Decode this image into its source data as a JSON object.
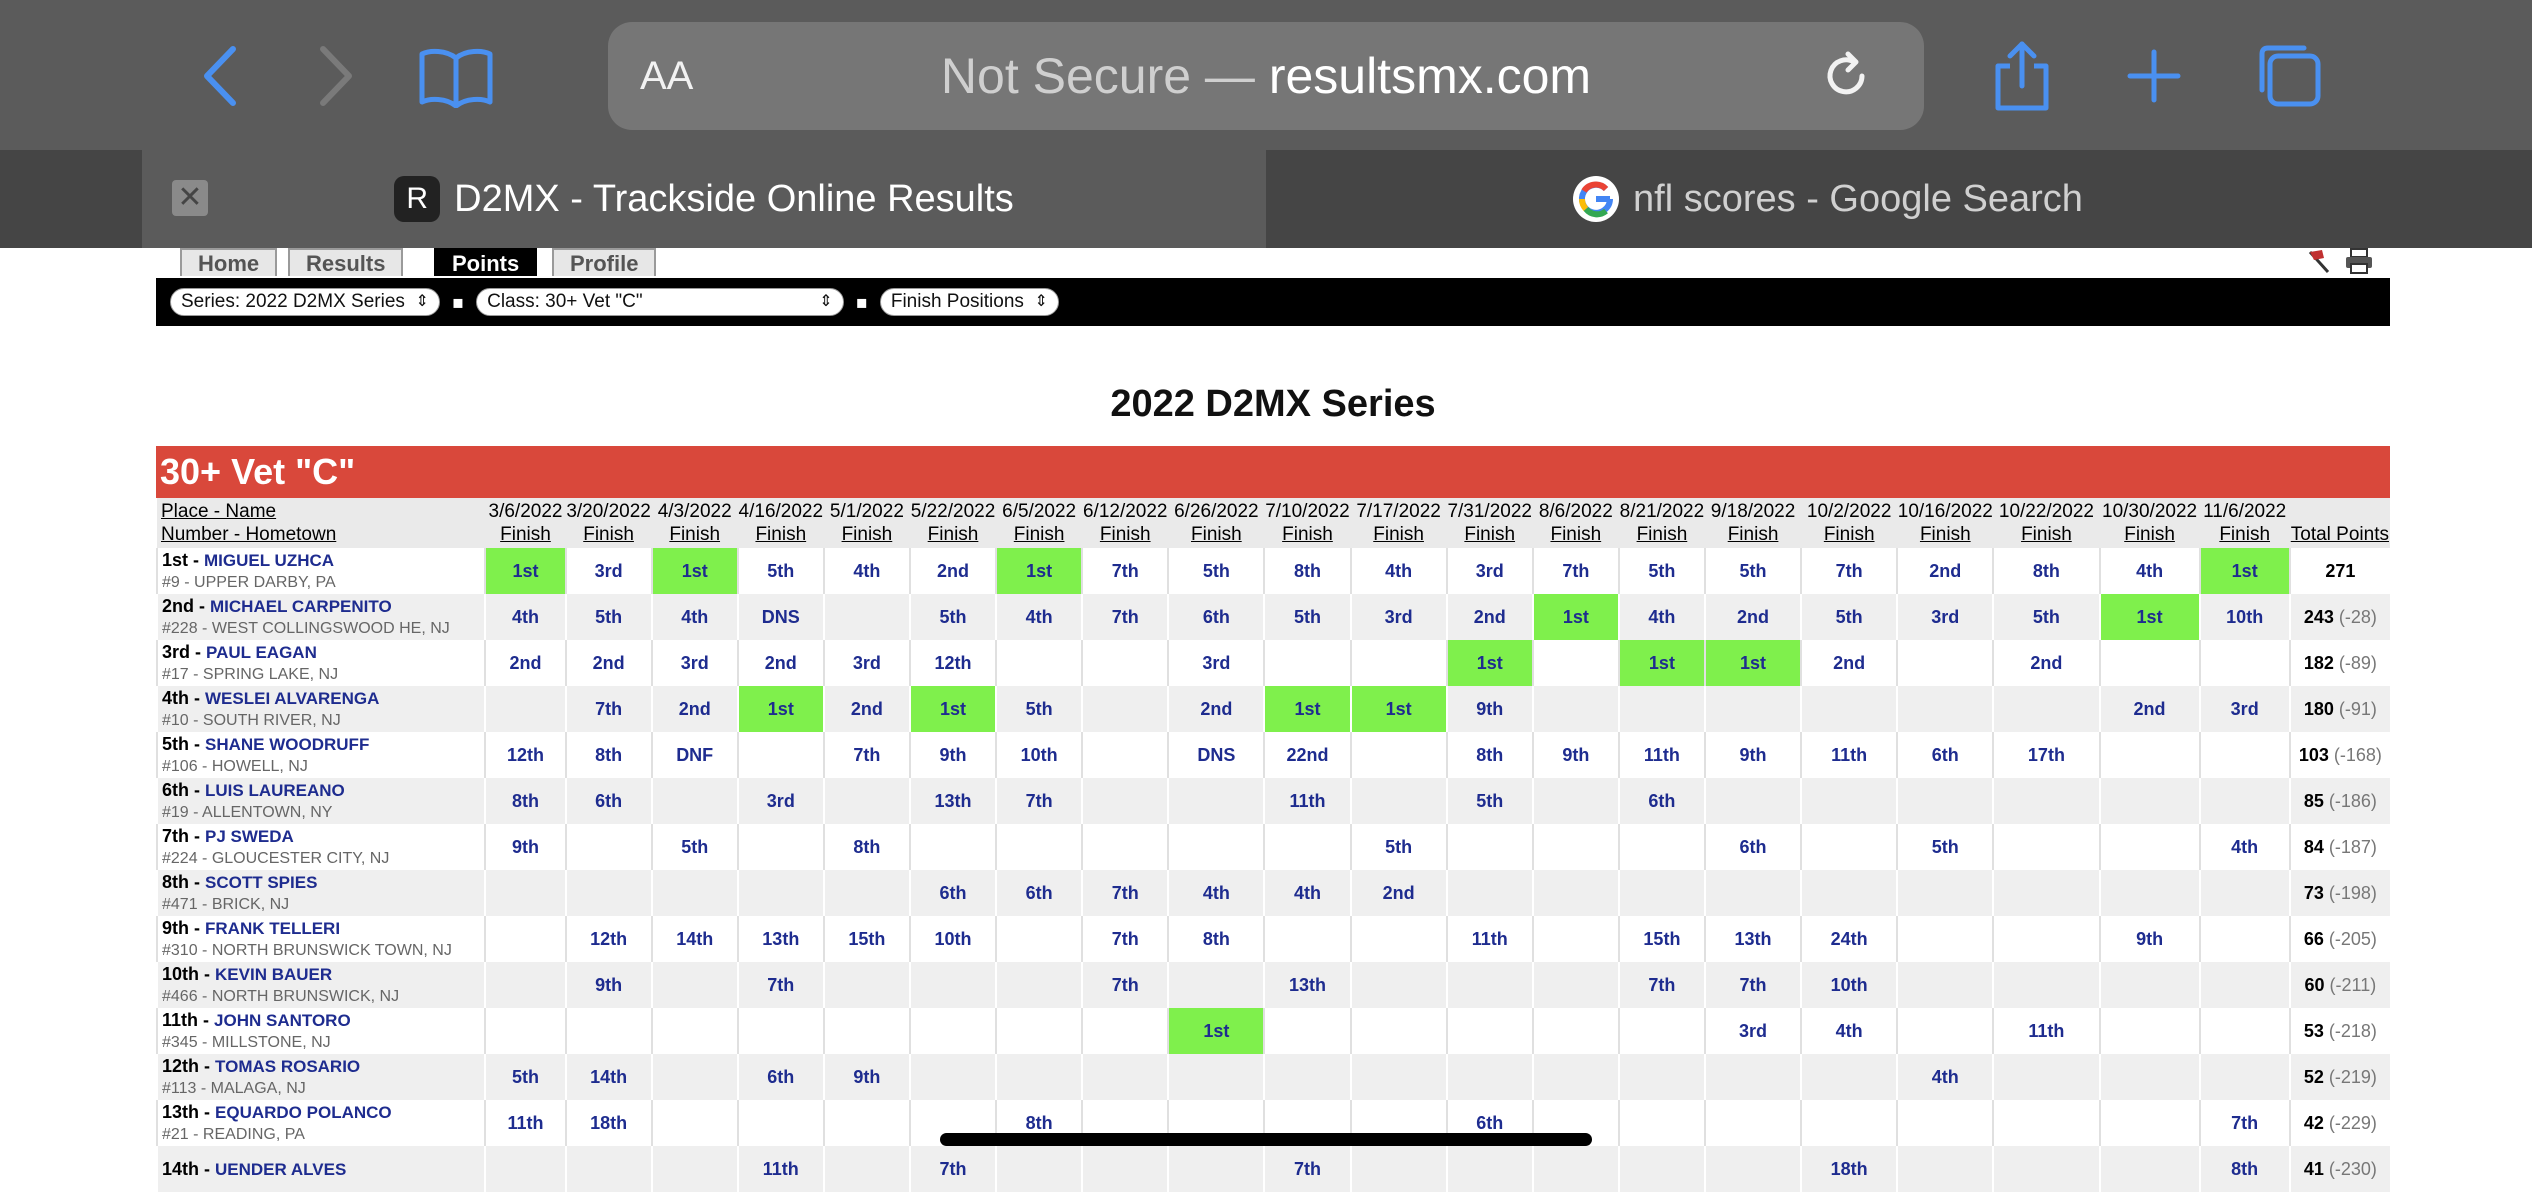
{
  "browser": {
    "address_aa": "AA",
    "address_prefix": "Not Secure — ",
    "address_domain": "resultsmx.com",
    "tabs": [
      {
        "title": "D2MX - Trackside Online Results",
        "favicon": "R"
      },
      {
        "title": "nfl scores - Google Search",
        "favicon": "google-icon"
      }
    ]
  },
  "nav": {
    "tabs": [
      "Home",
      "Results",
      "Points",
      "Profile"
    ],
    "active": "Points"
  },
  "filters": {
    "series": "Series: 2022 D2MX Series",
    "class": "Class: 30+ Vet \"C\"",
    "view": "Finish Positions"
  },
  "series_title": "2022 D2MX Series",
  "class_name": "30+ Vet \"C\"",
  "table": {
    "header_place_name": "Place - Name",
    "header_number_hometown": "Number - Hometown",
    "header_finish": "Finish",
    "header_total": "Total Points",
    "dates": [
      "3/6/2022",
      "3/20/2022",
      "4/3/2022",
      "4/16/2022",
      "5/1/2022",
      "5/22/2022",
      "6/5/2022",
      "6/12/2022",
      "6/26/2022",
      "7/10/2022",
      "7/17/2022",
      "7/31/2022",
      "8/6/2022",
      "8/21/2022",
      "9/18/2022",
      "10/2/2022",
      "10/16/2022",
      "10/22/2022",
      "10/30/2022",
      "11/6/2022"
    ],
    "rows": [
      {
        "place": "1st",
        "name": "MIGUEL UZHCA",
        "home": "#9 - UPPER DARBY, PA",
        "results": [
          "1st",
          "3rd",
          "1st",
          "5th",
          "4th",
          "2nd",
          "1st",
          "7th",
          "5th",
          "8th",
          "4th",
          "3rd",
          "7th",
          "5th",
          "5th",
          "7th",
          "2nd",
          "8th",
          "4th",
          "1st"
        ],
        "total": "271",
        "diff": ""
      },
      {
        "place": "2nd",
        "name": "MICHAEL CARPENITO",
        "home": "#228 - WEST COLLINGSWOOD HE, NJ",
        "results": [
          "4th",
          "5th",
          "4th",
          "DNS",
          "",
          "5th",
          "4th",
          "7th",
          "6th",
          "5th",
          "3rd",
          "2nd",
          "1st",
          "4th",
          "2nd",
          "5th",
          "3rd",
          "5th",
          "1st",
          "10th"
        ],
        "total": "243",
        "diff": "(-28)"
      },
      {
        "place": "3rd",
        "name": "PAUL EAGAN",
        "home": "#17 - SPRING LAKE, NJ",
        "results": [
          "2nd",
          "2nd",
          "3rd",
          "2nd",
          "3rd",
          "12th",
          "",
          "",
          "3rd",
          "",
          "",
          "1st",
          "",
          "1st",
          "1st",
          "2nd",
          "",
          "2nd",
          "",
          ""
        ],
        "total": "182",
        "diff": "(-89)"
      },
      {
        "place": "4th",
        "name": "WESLEI ALVARENGA",
        "home": "#10 - SOUTH RIVER, NJ",
        "results": [
          "",
          "7th",
          "2nd",
          "1st",
          "2nd",
          "1st",
          "5th",
          "",
          "2nd",
          "1st",
          "1st",
          "9th",
          "",
          "",
          "",
          "",
          "",
          "",
          "2nd",
          "3rd"
        ],
        "total": "180",
        "diff": "(-91)"
      },
      {
        "place": "5th",
        "name": "SHANE WOODRUFF",
        "home": "#106 - HOWELL, NJ",
        "results": [
          "12th",
          "8th",
          "DNF",
          "",
          "7th",
          "9th",
          "10th",
          "",
          "DNS",
          "22nd",
          "",
          "8th",
          "9th",
          "11th",
          "9th",
          "11th",
          "6th",
          "17th",
          "",
          ""
        ],
        "total": "103",
        "diff": "(-168)"
      },
      {
        "place": "6th",
        "name": "LUIS LAUREANO",
        "home": "#19 - ALLENTOWN, NY",
        "results": [
          "8th",
          "6th",
          "",
          "3rd",
          "",
          "13th",
          "7th",
          "",
          "",
          "11th",
          "",
          "5th",
          "",
          "6th",
          "",
          "",
          "",
          "",
          "",
          ""
        ],
        "total": "85",
        "diff": "(-186)"
      },
      {
        "place": "7th",
        "name": "PJ SWEDA",
        "home": "#224 - GLOUCESTER CITY, NJ",
        "results": [
          "9th",
          "",
          "5th",
          "",
          "8th",
          "",
          "",
          "",
          "",
          "",
          "5th",
          "",
          "",
          "",
          "6th",
          "",
          "5th",
          "",
          "",
          "4th"
        ],
        "total": "84",
        "diff": "(-187)"
      },
      {
        "place": "8th",
        "name": "SCOTT SPIES",
        "home": "#471 - BRICK, NJ",
        "results": [
          "",
          "",
          "",
          "",
          "",
          "6th",
          "6th",
          "7th",
          "4th",
          "4th",
          "2nd",
          "",
          "",
          "",
          "",
          "",
          "",
          "",
          "",
          ""
        ],
        "total": "73",
        "diff": "(-198)"
      },
      {
        "place": "9th",
        "name": "FRANK TELLERI",
        "home": "#310 - NORTH BRUNSWICK TOWN, NJ",
        "results": [
          "",
          "12th",
          "14th",
          "13th",
          "15th",
          "10th",
          "",
          "7th",
          "8th",
          "",
          "",
          "11th",
          "",
          "15th",
          "13th",
          "24th",
          "",
          "",
          "9th",
          ""
        ],
        "total": "66",
        "diff": "(-205)"
      },
      {
        "place": "10th",
        "name": "KEVIN BAUER",
        "home": "#466 - NORTH BRUNSWICK, NJ",
        "results": [
          "",
          "9th",
          "",
          "7th",
          "",
          "",
          "",
          "7th",
          "",
          "13th",
          "",
          "",
          "",
          "7th",
          "7th",
          "10th",
          "",
          "",
          "",
          ""
        ],
        "total": "60",
        "diff": "(-211)"
      },
      {
        "place": "11th",
        "name": "JOHN SANTORO",
        "home": "#345 - MILLSTONE, NJ",
        "results": [
          "",
          "",
          "",
          "",
          "",
          "",
          "",
          "",
          "1st",
          "",
          "",
          "",
          "",
          "",
          "3rd",
          "4th",
          "",
          "11th",
          "",
          ""
        ],
        "total": "53",
        "diff": "(-218)"
      },
      {
        "place": "12th",
        "name": "TOMAS ROSARIO",
        "home": "#113 - MALAGA, NJ",
        "results": [
          "5th",
          "14th",
          "",
          "6th",
          "9th",
          "",
          "",
          "",
          "",
          "",
          "",
          "",
          "",
          "",
          "",
          "",
          "4th",
          "",
          "",
          ""
        ],
        "total": "52",
        "diff": "(-219)"
      },
      {
        "place": "13th",
        "name": "EQUARDO POLANCO",
        "home": "#21 - READING, PA",
        "results": [
          "11th",
          "18th",
          "",
          "",
          "",
          "",
          "8th",
          "",
          "",
          "",
          "",
          "6th",
          "",
          "",
          "",
          "",
          "",
          "",
          "",
          "7th"
        ],
        "total": "42",
        "diff": "(-229)"
      },
      {
        "place": "14th",
        "name": "UENDER ALVES",
        "home": "",
        "results": [
          "",
          "",
          "",
          "11th",
          "",
          "7th",
          "",
          "",
          "",
          "7th",
          "",
          "",
          "",
          "",
          "",
          "18th",
          "",
          "",
          "",
          "8th"
        ],
        "total": "41",
        "diff": "(-230)"
      }
    ]
  },
  "colors": {
    "win": "#7ff04c",
    "banner": "#d9483b",
    "link": "#1e2c8f"
  }
}
